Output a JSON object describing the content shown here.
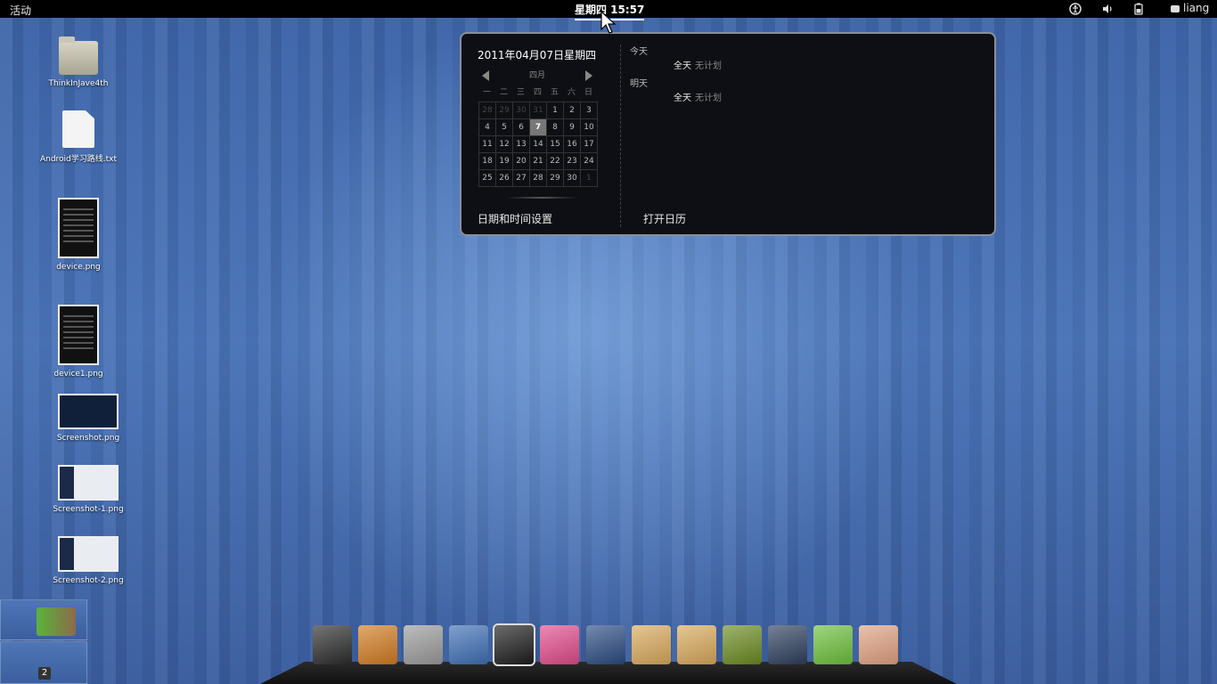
{
  "topbar": {
    "activities": "活动",
    "clock": "星期四 15:57",
    "user": "liang"
  },
  "calendar": {
    "full_date": "2011年04月07日星期四",
    "month": "四月",
    "weekdays": [
      "一",
      "二",
      "三",
      "四",
      "五",
      "六",
      "日"
    ],
    "weeks": [
      [
        "28",
        "29",
        "30",
        "31",
        "1",
        "2",
        "3"
      ],
      [
        "4",
        "5",
        "6",
        "7",
        "8",
        "9",
        "10"
      ],
      [
        "11",
        "12",
        "13",
        "14",
        "15",
        "16",
        "17"
      ],
      [
        "18",
        "19",
        "20",
        "21",
        "22",
        "23",
        "24"
      ],
      [
        "25",
        "26",
        "27",
        "28",
        "29",
        "30",
        "1"
      ]
    ],
    "today": "7",
    "events": [
      {
        "heading": "今天",
        "allday": "全天",
        "text": "无计划"
      },
      {
        "heading": "明天",
        "allday": "全天",
        "text": "无计划"
      }
    ],
    "settings_link": "日期和时间设置",
    "open_calendar_link": "打开日历"
  },
  "desktop_icons": [
    {
      "label": "ThinkInJave4th",
      "kind": "folder"
    },
    {
      "label": "Android学习路线.txt",
      "kind": "text-file"
    },
    {
      "label": "device.png",
      "kind": "image"
    },
    {
      "label": "device1.png",
      "kind": "image"
    },
    {
      "label": "Screenshot.png",
      "kind": "image"
    },
    {
      "label": "Screenshot-1.png",
      "kind": "image"
    },
    {
      "label": "Screenshot-2.png",
      "kind": "image"
    }
  ],
  "workspaces": {
    "badge": "2"
  },
  "dock": [
    {
      "icon": "terminal-icon",
      "color": "#2b2b2b"
    },
    {
      "icon": "eye-app-icon",
      "color": "#d07a20"
    },
    {
      "icon": "calculator-icon",
      "color": "#9a9a9a"
    },
    {
      "icon": "gnome-foot-icon",
      "color": "#3d6eb4"
    },
    {
      "icon": "remote-desktop-icon",
      "color": "#1c1c1c"
    },
    {
      "icon": "color-wheel-icon",
      "color": "#e04a8a"
    },
    {
      "icon": "tablet-icon",
      "color": "#2a4a80"
    },
    {
      "icon": "documents-folder-icon",
      "color": "#d8a85a"
    },
    {
      "icon": "downloads-folder-icon",
      "color": "#d8a85a"
    },
    {
      "icon": "media-player-icon",
      "color": "#6a8a20"
    },
    {
      "icon": "power-icon",
      "color": "#2c3e5c"
    },
    {
      "icon": "archive-manager-icon",
      "color": "#6cbf3a"
    },
    {
      "icon": "shell-app-icon",
      "color": "#e0a080"
    }
  ]
}
